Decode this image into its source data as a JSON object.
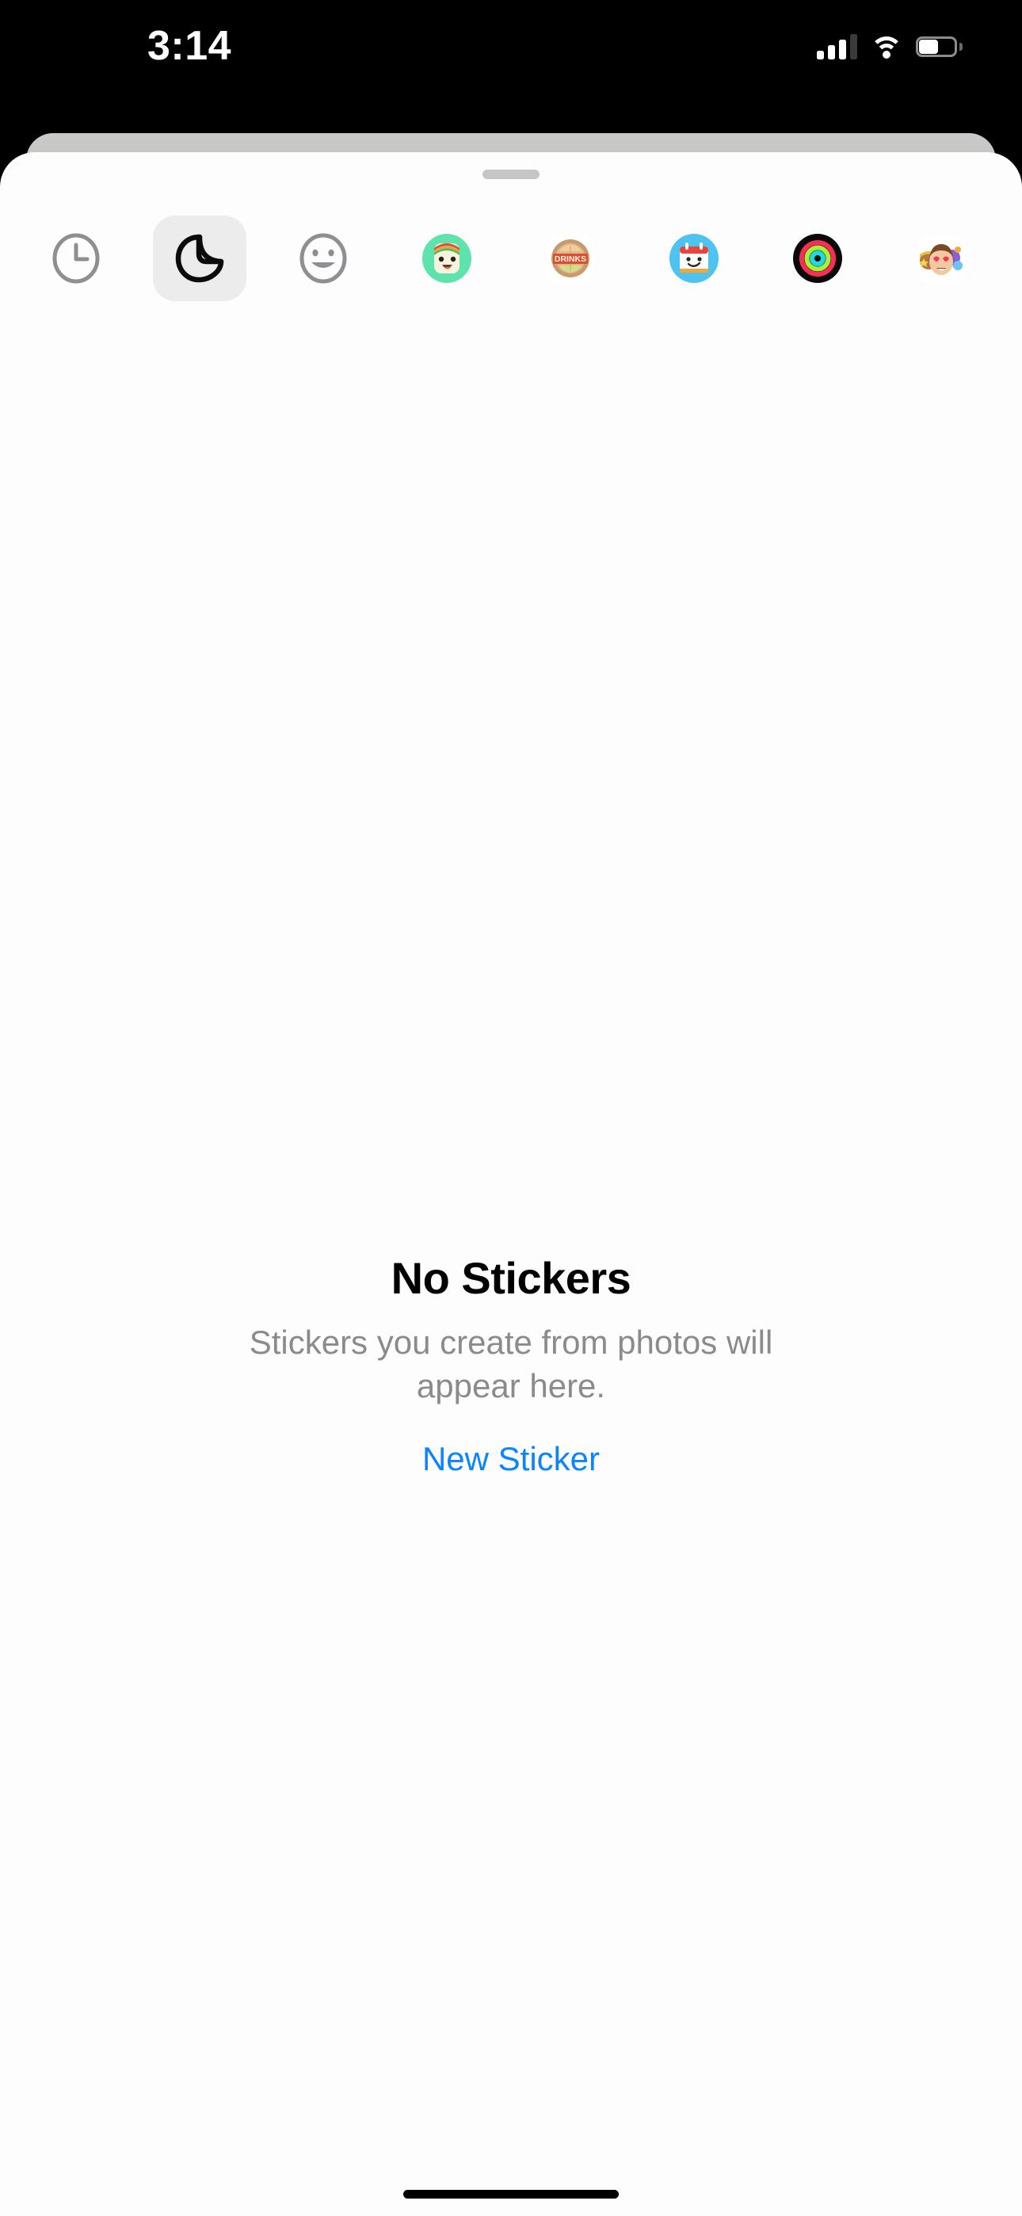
{
  "status_bar": {
    "time": "3:14",
    "cellular_icon": "cellular-signal-icon",
    "wifi_icon": "wifi-icon",
    "battery_icon": "battery-icon",
    "battery_level_percent": 55
  },
  "sheet": {
    "grabber_label": "sheet-grabber"
  },
  "app_drawer": {
    "apps": [
      {
        "id": "recents",
        "label": "Recents",
        "icon": "clock-icon",
        "selected": false,
        "type": "outline"
      },
      {
        "id": "stickers",
        "label": "Stickers",
        "icon": "sticker-peel-icon",
        "selected": true,
        "type": "outline"
      },
      {
        "id": "emoji",
        "label": "Emoji",
        "icon": "smiley-face-icon",
        "selected": false,
        "type": "outline"
      },
      {
        "id": "memoji",
        "label": "Memoji",
        "icon": "memoji-avatar-icon",
        "selected": false,
        "type": "image",
        "bg": "#5de3ab"
      },
      {
        "id": "drinks",
        "label": "Drinks",
        "icon": "drinks-badge-icon",
        "selected": false,
        "type": "image",
        "bg": "#ffffff",
        "badge_text": "DRINKS"
      },
      {
        "id": "calendar",
        "label": "Calendar",
        "icon": "calendar-face-icon",
        "selected": false,
        "type": "image",
        "bg": "#4ec3f0"
      },
      {
        "id": "fitness",
        "label": "Fitness",
        "icon": "activity-rings-icon",
        "selected": false,
        "type": "image",
        "bg": "#0a0a0a"
      },
      {
        "id": "memojis",
        "label": "Memoji Pack",
        "icon": "memoji-group-icon",
        "selected": false,
        "type": "image",
        "bg": "#ffffff"
      }
    ]
  },
  "empty_state": {
    "title": "No Stickers",
    "description": "Stickers you create from photos will appear here.",
    "action_label": "New Sticker",
    "action_color": "#0a84ff"
  },
  "home_indicator": {
    "label": "home-indicator"
  },
  "colors": {
    "sheet_background": "#fdfdfd",
    "sheet_behind": "#c6c7c5",
    "selected_pill": "#ececec",
    "secondary_text": "#8b8b8d",
    "accent": "#0a84ff"
  }
}
